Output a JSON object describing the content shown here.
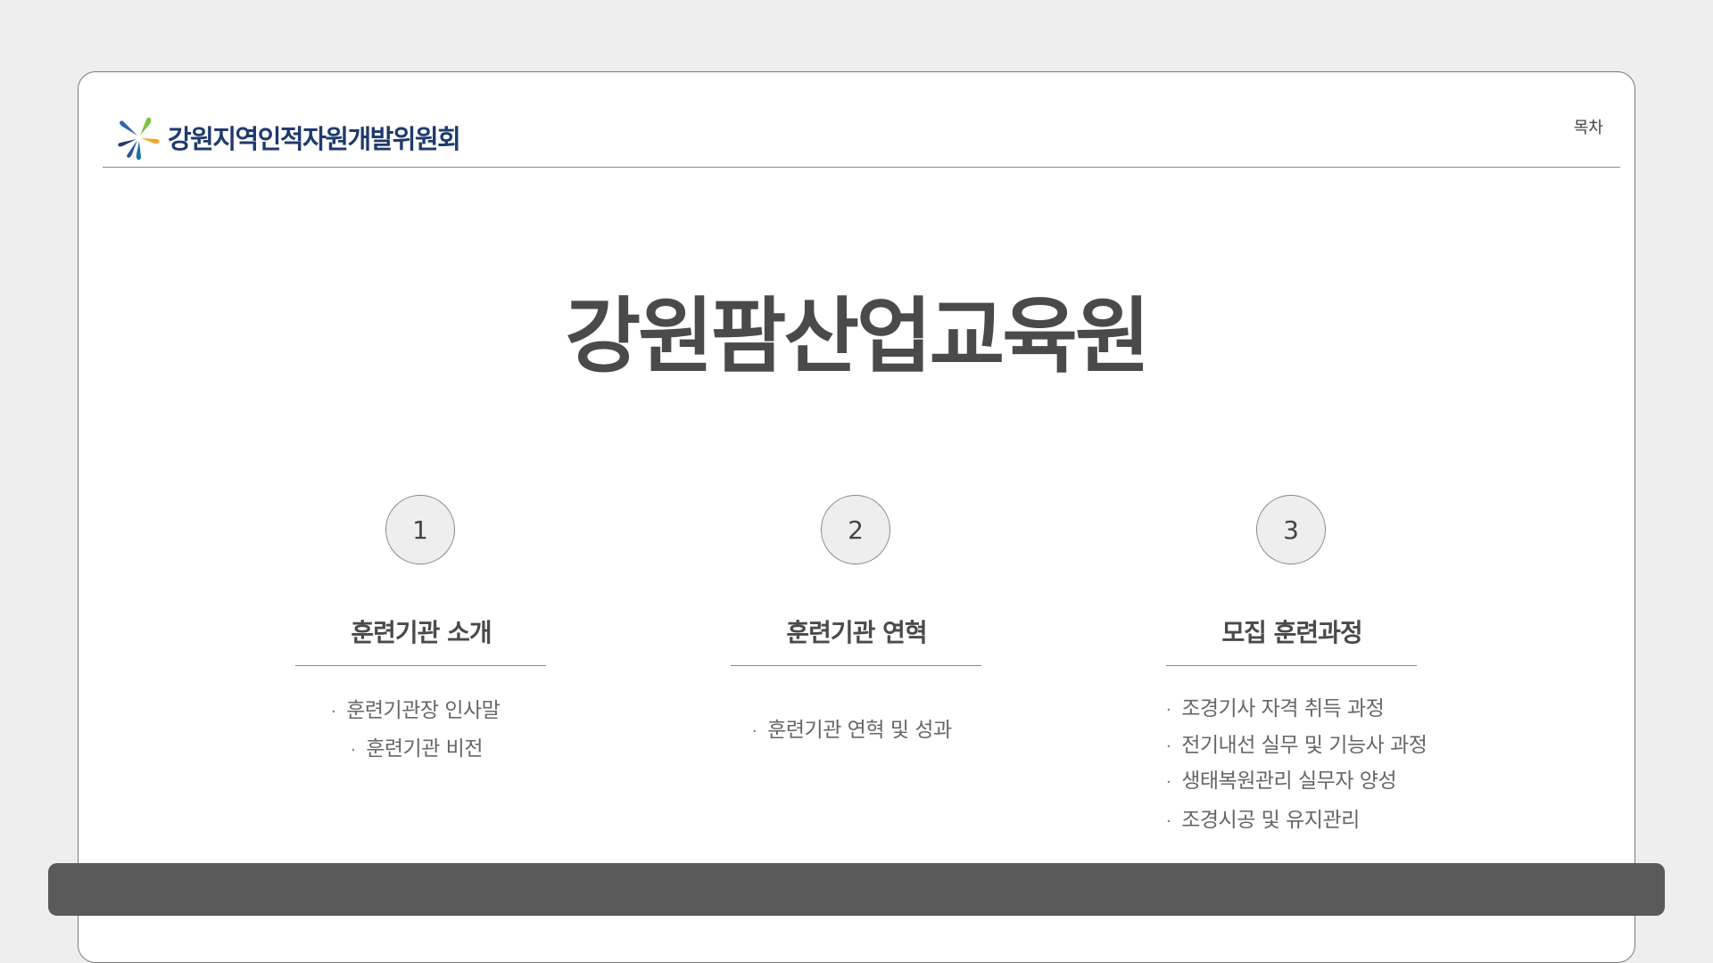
{
  "header": {
    "org_name": "강원지역인적자원개발위원회",
    "toc_label": "목차",
    "logo_icon": "colorful-pinwheel-logo-icon"
  },
  "main": {
    "title": "강원팜산업교육원"
  },
  "sections": [
    {
      "number": "1",
      "title": "훈련기관 소개",
      "items": [
        "훈련기관장 인사말",
        "훈련기관 비전"
      ]
    },
    {
      "number": "2",
      "title": "훈련기관 연혁",
      "items": [
        "훈련기관 연혁 및 성과"
      ]
    },
    {
      "number": "3",
      "title": "모집 훈련과정",
      "items": [
        "조경기사 자격 취득 과정",
        "전기내선 실무 및 기능사 과정",
        "생태복원관리 실무자 양성",
        "조경시공 및 유지관리"
      ]
    }
  ],
  "colors": {
    "background": "#eeeeee",
    "card": "#ffffff",
    "title_text": "#4a4a4a",
    "logo_text": "#1f3a6e",
    "footer_bar": "#5a5a5a"
  }
}
